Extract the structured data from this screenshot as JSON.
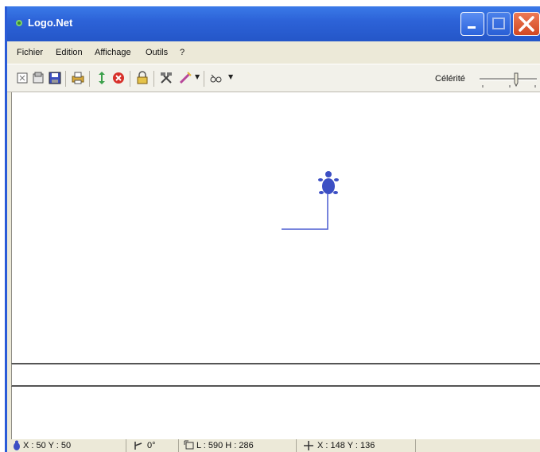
{
  "window": {
    "title": "Logo.Net"
  },
  "menu": {
    "items": [
      "Fichier",
      "Edition",
      "Affichage",
      "Outils",
      "?"
    ]
  },
  "toolbar": {
    "icons": [
      "new-icon",
      "open-icon",
      "save-icon",
      "print-icon",
      "refresh-icon",
      "stop-icon",
      "lock-icon",
      "tools-icon",
      "pen-icon",
      "turtle-view-icon"
    ],
    "speed_label": "Célérité"
  },
  "canvas": {
    "turtle_color": "#3c4fc4",
    "line_color": "#4a5bd0"
  },
  "command": {
    "value": ""
  },
  "status": {
    "turtle_pos": "X : 50  Y : 50",
    "heading": "0°",
    "size": "L : 590  H : 286",
    "cursor": "X : 148  Y : 136"
  },
  "colors": {
    "titlebar": "#2d63d8",
    "close": "#d24822"
  }
}
